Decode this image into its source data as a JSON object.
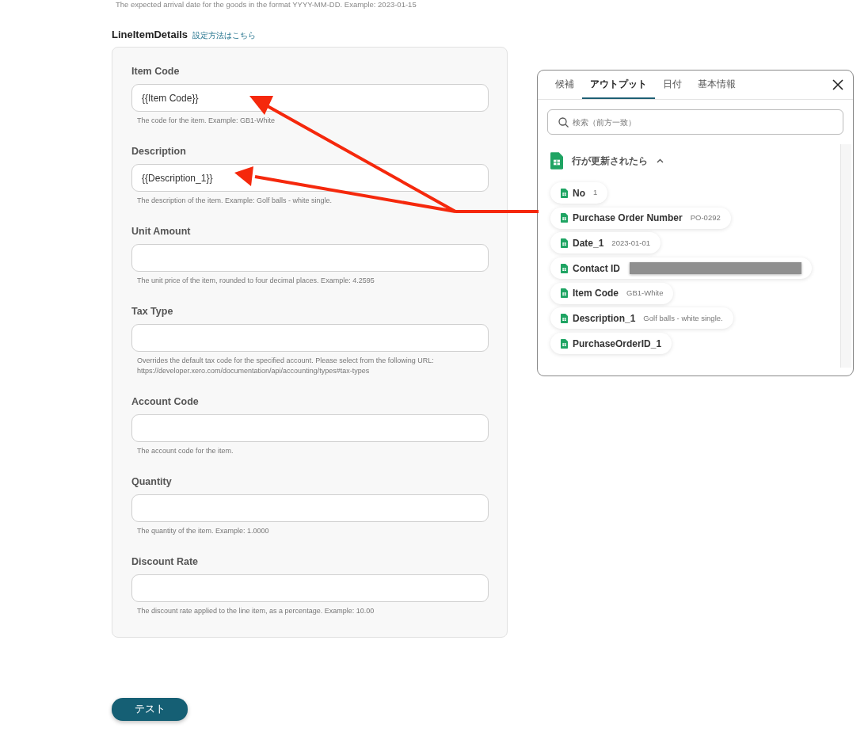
{
  "top_hint": "The expected arrival date for the goods in the format YYYY-MM-DD. Example: 2023-01-15",
  "section": {
    "title": "LineItemDetails",
    "help_link": "設定方法はこちら"
  },
  "fields": [
    {
      "label": "Item Code",
      "value": "{{Item Code}}",
      "help": "The code for the item. Example: GB1-White"
    },
    {
      "label": "Description",
      "value": "{{Description_1}}",
      "help": "The description of the item. Example: Golf balls - white single."
    },
    {
      "label": "Unit Amount",
      "help": "The unit price of the item, rounded to four decimal places. Example: 4.2595"
    },
    {
      "label": "Tax Type",
      "help": "Overrides the default tax code for the specified account. Please select from the following URL: https://developer.xero.com/documentation/api/accounting/types#tax-types"
    },
    {
      "label": "Account Code",
      "help": "The account code for the item."
    },
    {
      "label": "Quantity",
      "help": "The quantity of the item. Example: 1.0000"
    },
    {
      "label": "Discount Rate",
      "help": "The discount rate applied to the line item, as a percentage. Example: 10.00"
    }
  ],
  "test_button": "テスト",
  "popup": {
    "tabs": [
      {
        "label": "候補",
        "selected": false
      },
      {
        "label": "アウトプット",
        "selected": true
      },
      {
        "label": "日付",
        "selected": false
      },
      {
        "label": "基本情報",
        "selected": false
      }
    ],
    "search": {
      "placeholder": "検索（前方一致）"
    },
    "group": {
      "title": "行が更新されたら",
      "expanded": true
    },
    "items": [
      {
        "name": "No",
        "value": "1",
        "redacted": false
      },
      {
        "name": "Purchase Order Number",
        "value": "PO-0292",
        "redacted": false
      },
      {
        "name": "Date_1",
        "value": "2023-01-01",
        "redacted": false
      },
      {
        "name": "Contact ID",
        "redacted": true
      },
      {
        "name": "Item Code",
        "value": "GB1-White",
        "redacted": false
      },
      {
        "name": "Description_1",
        "value": "Golf balls - white single.",
        "redacted": false
      },
      {
        "name": "PurchaseOrderID_1",
        "redacted": false
      }
    ]
  }
}
